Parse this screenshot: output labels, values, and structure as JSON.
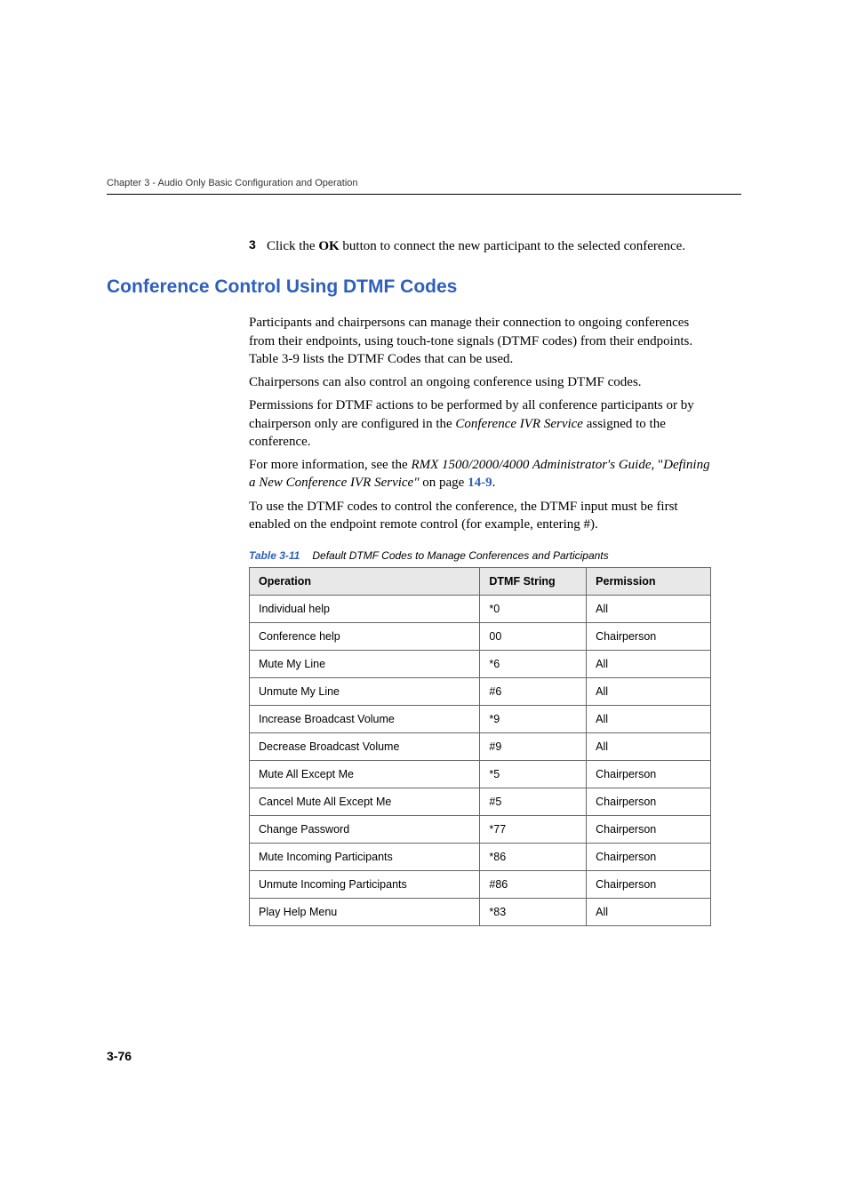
{
  "chapter_header": "Chapter 3 - Audio Only Basic Configuration and Operation",
  "step": {
    "num": "3",
    "pre": "Click the ",
    "bold": "OK",
    "post": " button to connect the new participant to the selected conference."
  },
  "section_heading": "Conference Control Using DTMF Codes",
  "paragraphs": {
    "p1": "Participants and chairpersons can manage their connection to ongoing conferences from their endpoints, using touch-tone signals (DTMF codes) from their endpoints. Table 3-9 lists the DTMF Codes that can be used.",
    "p2": "Chairpersons can also control an ongoing conference using DTMF codes.",
    "p3_pre": "Permissions for DTMF actions to be performed by all conference participants or by chairperson only are configured in the ",
    "p3_italic": "Conference IVR Service",
    "p3_post": " assigned to the conference.",
    "p4_pre": "For more information, see the ",
    "p4_italic1": "RMX 1500/2000/4000 Administrator's Guide",
    "p4_mid": ", \"",
    "p4_italic2": "Defining a New Conference IVR Service\"",
    "p4_onpage": " on page ",
    "p4_ref": "14-9",
    "p4_end": ".",
    "p5": "To use the DTMF codes to control the conference, the DTMF input must be first enabled on the endpoint remote control (for example, entering #)."
  },
  "table": {
    "label": "Table 3-11",
    "caption": "Default DTMF Codes to Manage Conferences and Participants",
    "headers": {
      "c1": "Operation",
      "c2": "DTMF String",
      "c3": "Permission"
    },
    "rows": [
      {
        "op": "Individual help",
        "code": "*0",
        "perm": "All"
      },
      {
        "op": "Conference help",
        "code": "00",
        "perm": "Chairperson"
      },
      {
        "op": "Mute My Line",
        "code": "*6",
        "perm": "All"
      },
      {
        "op": "Unmute My Line",
        "code": "#6",
        "perm": "All"
      },
      {
        "op": "Increase Broadcast Volume",
        "code": "*9",
        "perm": "All"
      },
      {
        "op": "Decrease Broadcast Volume",
        "code": "#9",
        "perm": "All"
      },
      {
        "op": "Mute All Except Me",
        "code": "*5",
        "perm": "Chairperson"
      },
      {
        "op": "Cancel Mute All Except Me",
        "code": "#5",
        "perm": "Chairperson"
      },
      {
        "op": "Change Password",
        "code": "*77",
        "perm": "Chairperson"
      },
      {
        "op": "Mute Incoming Participants",
        "code": "*86",
        "perm": "Chairperson"
      },
      {
        "op": "Unmute Incoming Participants",
        "code": "#86",
        "perm": "Chairperson"
      },
      {
        "op": "Play Help Menu",
        "code": "*83",
        "perm": "All"
      }
    ]
  },
  "page_number": "3-76"
}
